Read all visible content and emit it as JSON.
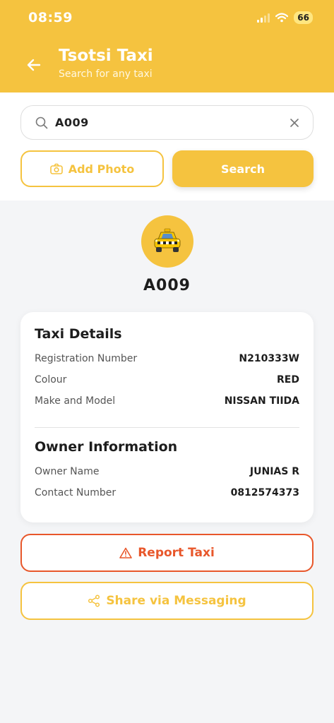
{
  "status_bar": {
    "time": "08:59",
    "battery": "66"
  },
  "header": {
    "title": "Tsotsi Taxi",
    "subtitle": "Search for any taxi"
  },
  "search": {
    "value": "A009"
  },
  "buttons": {
    "add_photo": "Add Photo",
    "search": "Search",
    "report": "Report Taxi",
    "share": "Share via Messaging"
  },
  "result": {
    "plate": "A009"
  },
  "taxi_details": {
    "title": "Taxi Details",
    "rows": [
      {
        "label": "Registration Number",
        "value": "N210333W"
      },
      {
        "label": "Colour",
        "value": "RED"
      },
      {
        "label": "Make and Model",
        "value": "NISSAN TIIDA"
      }
    ]
  },
  "owner_info": {
    "title": "Owner Information",
    "rows": [
      {
        "label": "Owner Name",
        "value": "JUNIAS R"
      },
      {
        "label": "Contact Number",
        "value": "0812574373"
      }
    ]
  },
  "colors": {
    "accent": "#f5c33f",
    "danger": "#e8572b",
    "background": "#f4f5f7"
  },
  "icons": [
    "back-arrow-icon",
    "search-icon",
    "clear-icon",
    "camera-icon",
    "taxi-icon",
    "warning-icon",
    "share-icon",
    "wifi-icon",
    "signal-icon"
  ]
}
